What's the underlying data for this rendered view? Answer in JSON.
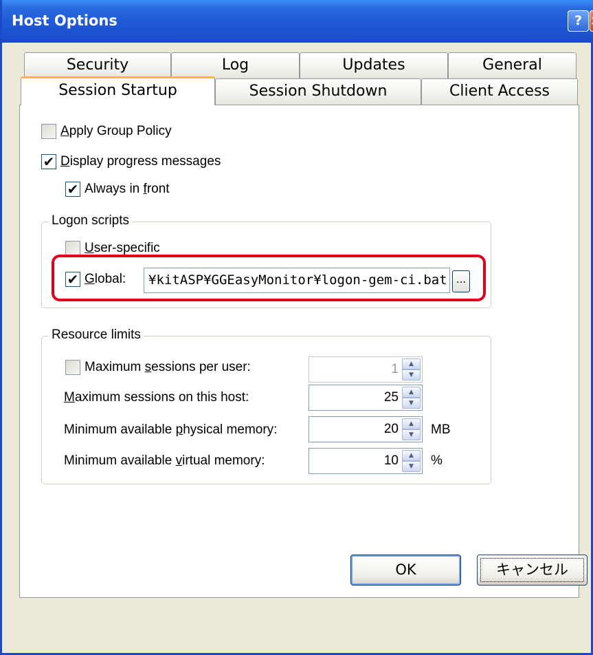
{
  "window": {
    "title": "Host Options",
    "help_label": "?",
    "close_label": "×"
  },
  "tabs": {
    "row_top": [
      "Security",
      "Log",
      "Updates",
      "General"
    ],
    "row_bottom": [
      "Session Startup",
      "Session Shutdown",
      "Client Access"
    ],
    "active": "Session Startup"
  },
  "options": {
    "apply_group_policy": {
      "label_pre": "",
      "label_key": "A",
      "label_post": "pply Group Policy",
      "checked": false
    },
    "display_progress": {
      "label_pre": "",
      "label_key": "D",
      "label_post": "isplay progress messages",
      "checked": true
    },
    "always_in_front": {
      "label_pre": "Always in ",
      "label_key": "f",
      "label_post": "ront",
      "checked": true
    }
  },
  "logon_scripts": {
    "title": "Logon scripts",
    "user_specific": {
      "label_pre": "",
      "label_key": "U",
      "label_post": "ser-specific",
      "checked": false
    },
    "global": {
      "label_pre": "",
      "label_key": "G",
      "label_post": "lobal:",
      "checked": true
    },
    "global_path": "¥kitASP¥GGEasyMonitor¥logon-gem-ci.bat",
    "browse_label": "..."
  },
  "resource_limits": {
    "title": "Resource limits",
    "max_sessions_user": {
      "label_pre": "Maximum ",
      "label_key": "s",
      "label_post": "essions per user:",
      "value": "1",
      "checked": false,
      "enabled": false
    },
    "max_sessions_host": {
      "label_pre": "",
      "label_key": "M",
      "label_post": "aximum sessions on this host:",
      "value": "25"
    },
    "min_physical_memory": {
      "label_pre": "Minimum available ",
      "label_key": "p",
      "label_post": "hysical memory:",
      "value": "20",
      "unit": "MB"
    },
    "min_virtual_memory": {
      "label_pre": "Minimum available ",
      "label_key": "v",
      "label_post": "irtual memory:",
      "value": "10",
      "unit": "%"
    }
  },
  "buttons": {
    "ok": "OK",
    "cancel": "キャンセル"
  },
  "colors": {
    "titlebar": "#1f5ad6",
    "highlight": "#e0001b",
    "tab_active_accent": "#f9b43c"
  }
}
